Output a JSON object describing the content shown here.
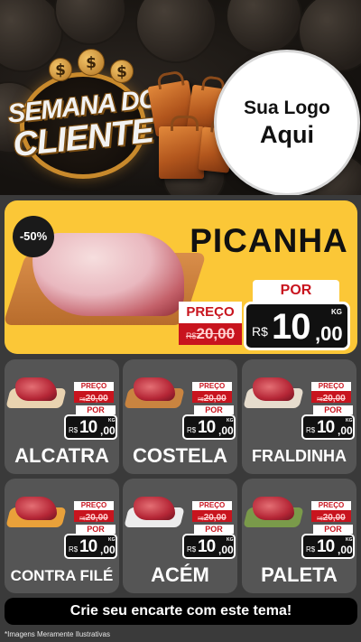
{
  "header": {
    "title_line1": "SEMANA DO",
    "title_line2": "CLIENTE",
    "dollar_symbol": "$",
    "logo_line1": "Sua Logo",
    "logo_line2": "Aqui"
  },
  "featured": {
    "discount": "-50%",
    "name": "PICANHA",
    "preco_label": "PREÇO",
    "old_currency": "R$",
    "old_price": "20,00",
    "por_label": "POR",
    "currency": "R$",
    "price_int": "10",
    "price_dec": ",00",
    "unit": "KG"
  },
  "price_labels": {
    "preco": "PREÇO",
    "old_currency": "R$",
    "old_price": "20,00",
    "por": "POR",
    "currency": "R$",
    "price_int": "10",
    "price_dec": ",00",
    "unit": "KG"
  },
  "products": [
    {
      "name": "ALCATRA"
    },
    {
      "name": "COSTELA"
    },
    {
      "name": "FRALDINHA"
    },
    {
      "name": "CONTRA FILÉ"
    },
    {
      "name": "ACÉM"
    },
    {
      "name": "PALETA"
    }
  ],
  "footer": {
    "cta": "Crie seu encarte com este tema!",
    "disclaimer": "*Imagens Meramente Ilustrativas"
  },
  "colors": {
    "featured_bg": "#fbc737",
    "card_bg": "#555555",
    "price_red": "#c8141e",
    "price_box": "#111111",
    "badge_gold": "#c98a2c"
  }
}
